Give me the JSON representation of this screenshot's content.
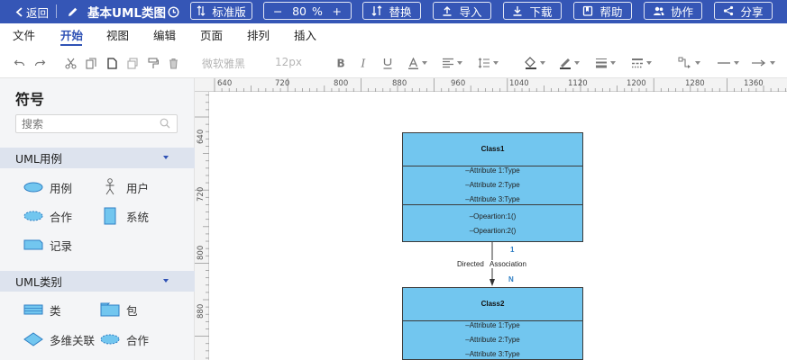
{
  "topbar": {
    "back_label": "返回",
    "doc_title": "基本UML类图",
    "standard_label": "标准版",
    "zoom_value": "80",
    "zoom_unit": "%",
    "zoom_minus": "−",
    "zoom_plus": "+",
    "replace_label": "替换",
    "import_label": "导入",
    "download_label": "下载",
    "help_label": "帮助",
    "collab_label": "协作",
    "share_label": "分享",
    "bar_color": "#3556b6"
  },
  "menu": {
    "items": [
      "文件",
      "开始",
      "视图",
      "编辑",
      "页面",
      "排列",
      "插入"
    ],
    "active_index": 1
  },
  "toolbar": {
    "font_name": "微软雅黑",
    "font_size": "12px"
  },
  "sidebar": {
    "title": "符号",
    "search_placeholder": "搜索",
    "sections": [
      {
        "label": "UML用例",
        "items": [
          "用例",
          "用户",
          "合作",
          "系统",
          "记录"
        ]
      },
      {
        "label": "UML类别",
        "items": [
          "类",
          "包",
          "多维关联",
          "合作"
        ]
      }
    ]
  },
  "rulers": {
    "top": [
      "640",
      "720",
      "800",
      "880",
      "960",
      "1040",
      "1120",
      "1200",
      "1280",
      "1360"
    ],
    "left": [
      "640",
      "720",
      "800",
      "880"
    ]
  },
  "diagram": {
    "class_fill": "#72c6ef",
    "class1": {
      "name": "Class1",
      "attributes": [
        "–Attribute 1:Type",
        "–Attribute 2:Type",
        "–Attribute 3:Type"
      ],
      "operations": [
        "–Opeartion:1()",
        "–Opeartion:2()"
      ]
    },
    "class2": {
      "name": "Class2",
      "attributes": [
        "–Attribute 1:Type",
        "–Attribute 2:Type",
        "–Attribute 3:Type"
      ]
    },
    "connector": {
      "label_left": "Directed",
      "label_right": "Association",
      "mult_top": "1",
      "mult_bottom": "N"
    }
  }
}
